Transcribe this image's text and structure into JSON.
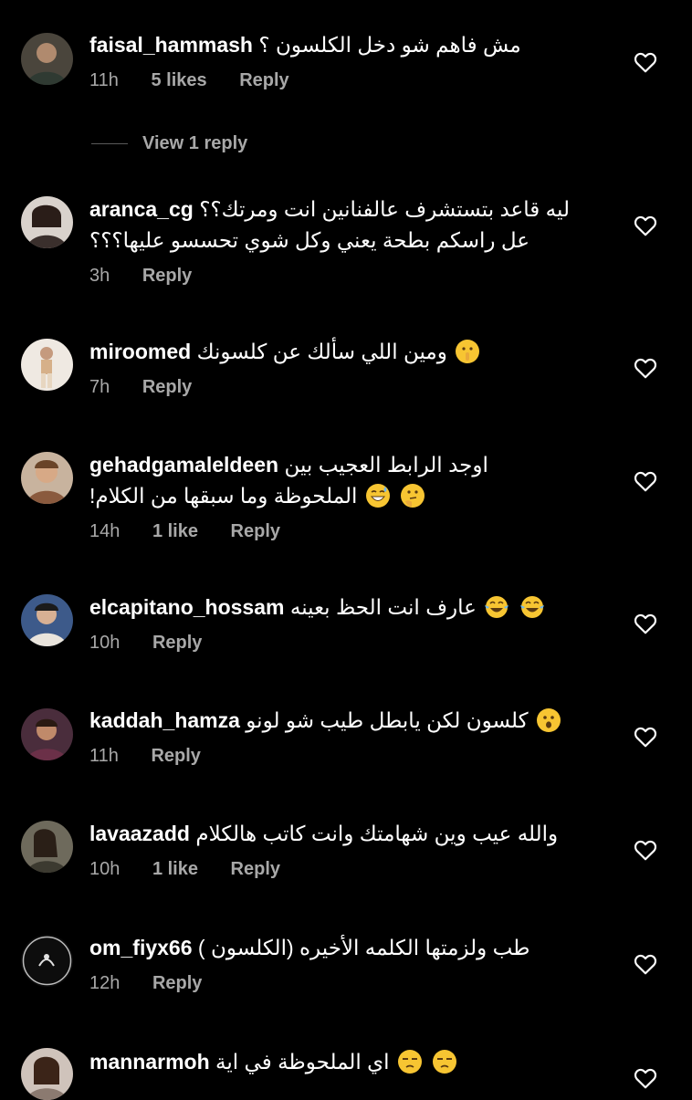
{
  "comments": [
    {
      "username": "faisal_hammash",
      "lines": [
        "مش فاهم شو دخل الكلسون ؟"
      ],
      "time": "11h",
      "likes": "5 likes",
      "reply": "Reply",
      "view_replies": "View 1 reply",
      "avatar_color": "#6b6152"
    },
    {
      "username": "aranca_cg",
      "lines": [
        "ليه قاعد بتستشرف عالفنانين انت ومرتك؟؟",
        "عل راسكم بطحة يعني وكل شوي تحسسو عليها؟؟؟"
      ],
      "time": "3h",
      "likes": "",
      "reply": "Reply",
      "avatar_color": "#8a7d78"
    },
    {
      "username": "miroomed",
      "lines": [
        "ومين اللي سألك عن كلسونك"
      ],
      "time": "7h",
      "likes": "",
      "reply": "Reply",
      "emoji": "shushing-face-emoji",
      "avatar_color": "#d8cbbd"
    },
    {
      "username": "gehadgamaleldeen",
      "lines": [
        "اوجد الرابط العجيب بين",
        "الملحوظة وما سبقها من الكلام!"
      ],
      "time": "14h",
      "likes": "1 like",
      "reply": "Reply",
      "emoji": [
        "thinking-face-emoji",
        "grinning-sweat-emoji"
      ],
      "avatar_color": "#9a7456"
    },
    {
      "username": "elcapitano_hossam",
      "lines": [
        "عارف انت الحظ بعينه"
      ],
      "time": "10h",
      "likes": "",
      "reply": "Reply",
      "emoji": [
        "tears-of-joy-emoji",
        "tears-of-joy-emoji"
      ],
      "avatar_color": "#4a5f86"
    },
    {
      "username": "kaddah_hamza",
      "lines": [
        "كلسون لكن يابطل طيب شو لونو"
      ],
      "time": "11h",
      "likes": "",
      "reply": "Reply",
      "emoji": "hushed-face-emoji",
      "avatar_color": "#5a3a4a"
    },
    {
      "username": "lavaazadd",
      "lines": [
        "والله عيب وين شهامتك وانت كاتب هالكلام"
      ],
      "time": "10h",
      "likes": "1 like",
      "reply": "Reply",
      "avatar_color": "#6e6a5c"
    },
    {
      "username": "om_fiyx66",
      "lines": [
        "طب ولزمتها الكلمه الأخيره (الكلسون )"
      ],
      "time": "12h",
      "likes": "",
      "reply": "Reply",
      "avatar_color": "#1a1a1a"
    },
    {
      "username": "mannarmoh",
      "lines": [
        "اي الملحوظة في اية"
      ],
      "time": "",
      "likes": "",
      "reply": "",
      "emoji": [
        "unamused-face-emoji",
        "unamused-face-emoji"
      ],
      "avatar_color": "#b9a9a0"
    }
  ],
  "colors": {
    "background": "#000000",
    "text": "#ffffff",
    "secondary_text": "#a8a8a8",
    "emoji_yellow": "#f7c532"
  },
  "icons": {
    "like": "heart-outline-icon"
  }
}
